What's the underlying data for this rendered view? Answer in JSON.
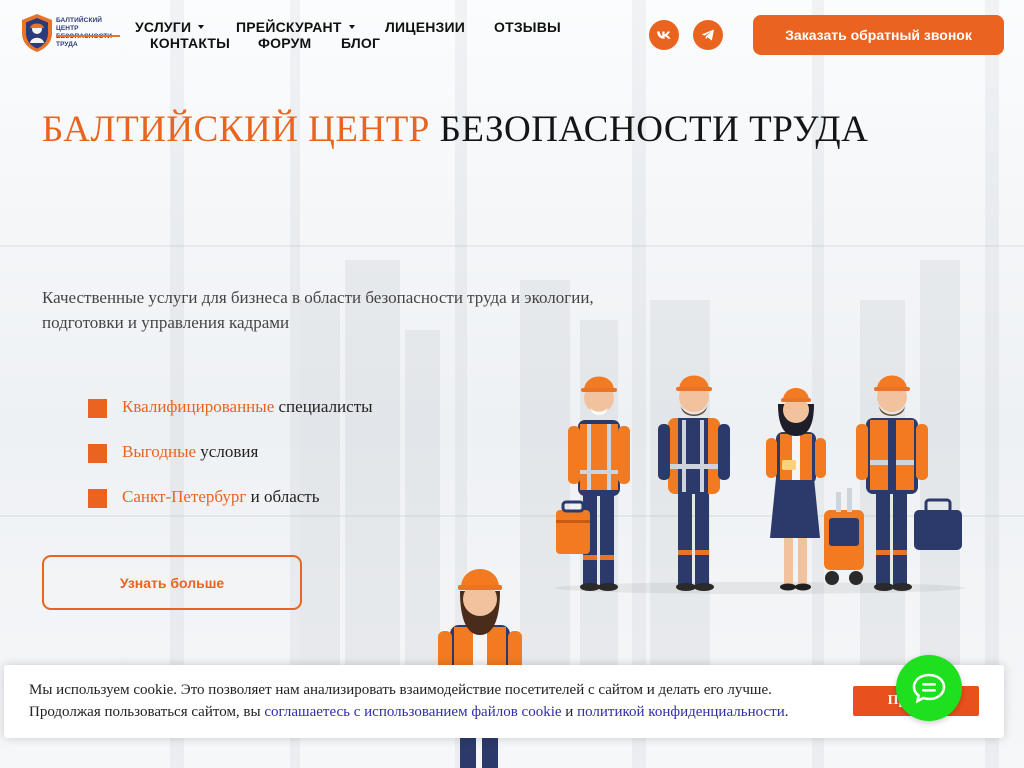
{
  "brand": {
    "logo_text": "БАЛТИЙСКИЙ ЦЕНТР БЕЗОПАСНОСТИ ТРУДА"
  },
  "nav": {
    "services": "Услуги",
    "pricelist": "Прейскурант",
    "licenses": "Лицензии",
    "reviews": "Отзывы",
    "contacts": "Контакты",
    "forum": "Форум",
    "blog": "Блог"
  },
  "social": {
    "vk_icon": "vk-icon",
    "telegram_icon": "telegram-icon"
  },
  "cta": {
    "callback_label": "Заказать обратный звонок"
  },
  "hero": {
    "title_highlight": "БАЛТИЙСКИЙ ЦЕНТР",
    "title_rest": "БЕЗОПАСНОСТИ ТРУДА",
    "description_line1": "Качественные услуги для бизнеса в области безопасности труда и экологии,",
    "description_line2": "подготовки и управления кадрами",
    "features": [
      {
        "highlight": "Квалифицированные",
        "rest": "специалисты"
      },
      {
        "highlight": "Выгодные",
        "rest": "условия"
      },
      {
        "highlight": "Санкт-Петербург",
        "rest": "и область"
      }
    ],
    "more_label": "Узнать больше"
  },
  "cookie": {
    "line1": "Мы используем cookie. Это позволяет нам анализировать взаимодействие посетителей с сайтом и делать его лучше.",
    "line2_prefix": "Продолжая пользоваться сайтом, вы",
    "link1": "соглашаетесь с использованием файлов cookie",
    "conj": "и",
    "link2": "политикой конфиденциальности",
    "end": ".",
    "accept_label": "Принять"
  },
  "colors": {
    "accent": "#e8641f",
    "chat": "#1ee01e",
    "link": "#2f2fa8"
  }
}
